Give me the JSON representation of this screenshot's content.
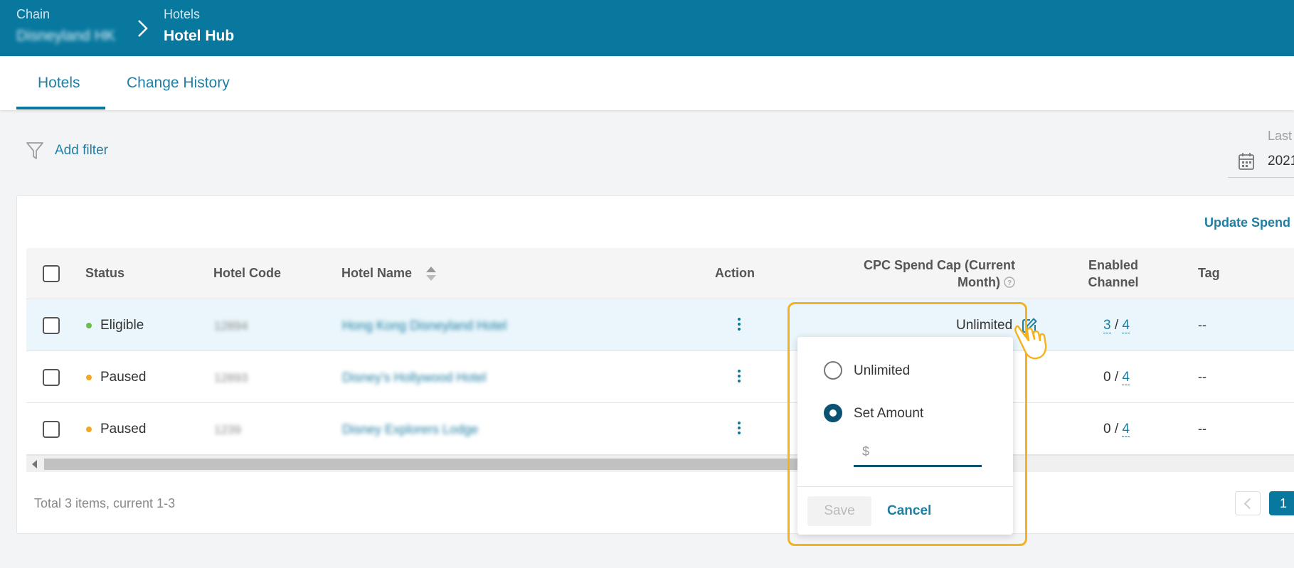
{
  "header": {
    "chain_label": "Chain",
    "chain_value": "Disneyland HK",
    "hotels_label": "Hotels",
    "hotels_value": "Hotel Hub"
  },
  "tabs": [
    {
      "label": "Hotels",
      "active": true
    },
    {
      "label": "Change History",
      "active": false
    }
  ],
  "filter": {
    "label": "Add filter"
  },
  "date": {
    "label": "Last",
    "value": "2021"
  },
  "actions": {
    "update_spend": "Update Spend"
  },
  "table": {
    "columns": {
      "status": "Status",
      "hotel_code": "Hotel Code",
      "hotel_name": "Hotel Name",
      "action": "Action",
      "cpc_line1": "CPC Spend Cap (Current",
      "cpc_line2": "Month)",
      "enabled_line1": "Enabled",
      "enabled_line2": "Channel",
      "tag": "Tag"
    },
    "rows": [
      {
        "status": "Eligible",
        "status_color": "#6cc04a",
        "code": "12894",
        "name": "Hong Kong Disneyland Hotel",
        "cap": "Unlimited",
        "enabled": "3",
        "total": "4",
        "tag": "--"
      },
      {
        "status": "Paused",
        "status_color": "#f5a623",
        "code": "12893",
        "name": "Disney's Hollywood Hotel",
        "cap": "",
        "enabled": "0",
        "total": "4",
        "tag": "--"
      },
      {
        "status": "Paused",
        "status_color": "#f5a623",
        "code": "1239",
        "name": "Disney Explorers Lodge",
        "cap": "",
        "enabled": "0",
        "total": "4",
        "tag": "--"
      }
    ]
  },
  "footer": {
    "total": "Total 3 items, current 1-3",
    "page": "1"
  },
  "popover": {
    "option_unlimited": "Unlimited",
    "option_set_amount": "Set Amount",
    "selected": "Set Amount",
    "amount_placeholder": "$",
    "save": "Save",
    "cancel": "Cancel"
  },
  "colors": {
    "header": "#08789f",
    "accent": "#1f7ea3",
    "highlight": "#f5b21b"
  }
}
